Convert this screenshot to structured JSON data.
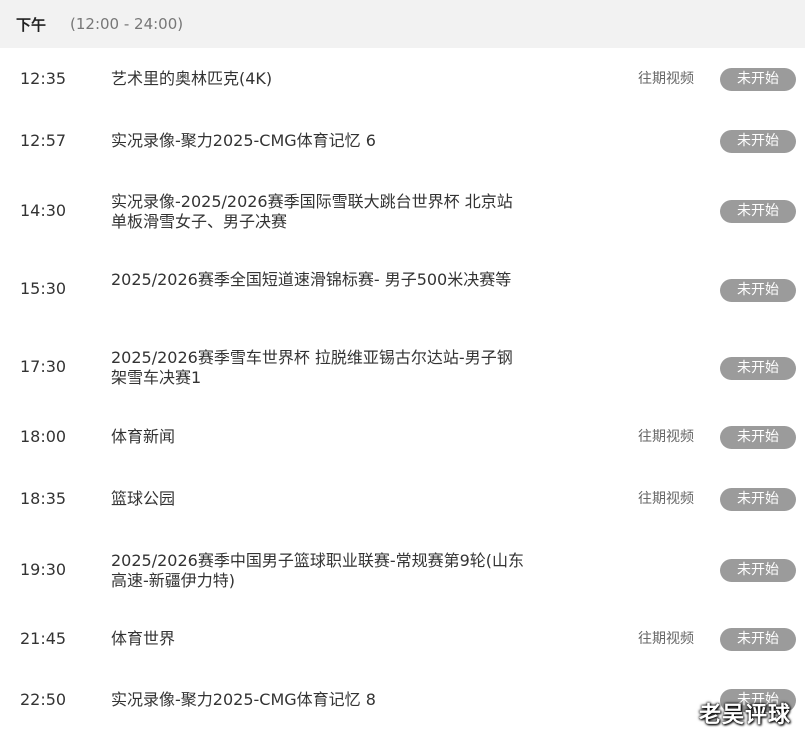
{
  "header": {
    "title": "下午",
    "range": "(12:00 - 24:00)"
  },
  "programs": [
    {
      "time": "12:35",
      "title": "艺术里的奥林匹克(4K)",
      "replay": "往期视频",
      "status": "未开始"
    },
    {
      "time": "12:57",
      "title": "实况录像-聚力2025-CMG体育记忆 6",
      "replay": "",
      "status": "未开始"
    },
    {
      "time": "14:30",
      "title": "实况录像-2025/2026赛季国际雪联大跳台世界杯 北京站 单板滑雪女子、男子决赛",
      "replay": "",
      "status": "未开始"
    },
    {
      "time": "15:30",
      "title": "2025/2026赛季全国短道速滑锦标赛- 男子500米决赛等",
      "replay": "",
      "status": "未开始"
    },
    {
      "time": "17:30",
      "title": "2025/2026赛季雪车世界杯 拉脱维亚锡古尔达站-男子钢架雪车决赛1",
      "replay": "",
      "status": "未开始"
    },
    {
      "time": "18:00",
      "title": "体育新闻",
      "replay": "往期视频",
      "status": "未开始"
    },
    {
      "time": "18:35",
      "title": "篮球公园",
      "replay": "往期视频",
      "status": "未开始"
    },
    {
      "time": "19:30",
      "title": "2025/2026赛季中国男子篮球职业联赛-常规赛第9轮(山东高速-新疆伊力特)",
      "replay": "",
      "status": "未开始"
    },
    {
      "time": "21:45",
      "title": "体育世界",
      "replay": "往期视频",
      "status": "未开始"
    },
    {
      "time": "22:50",
      "title": "实况录像-聚力2025-CMG体育记忆 8",
      "replay": "",
      "status": "未开始"
    }
  ],
  "watermark": "老吴评球"
}
